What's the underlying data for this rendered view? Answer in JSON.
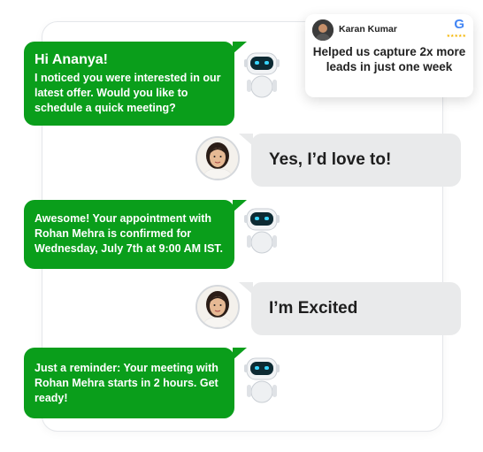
{
  "review": {
    "name": "Karan Kumar",
    "text": "Helped us capture 2x more leads in just one week",
    "logo_letter": "G",
    "stars": "★★★★★",
    "logo_icon": "google-g-icon"
  },
  "messages": [
    {
      "sender": "bot",
      "greeting": "Hi Ananya!",
      "text": "I noticed you were interested in our latest offer. Would you like to schedule a quick meeting?"
    },
    {
      "sender": "user",
      "text": "Yes, I’d love to!"
    },
    {
      "sender": "bot",
      "text": "Awesome! Your appointment with Rohan Mehra is confirmed for Wednesday, July 7th at 9:00 AM IST."
    },
    {
      "sender": "user",
      "text": "I’m Excited"
    },
    {
      "sender": "bot",
      "text": "Just a reminder: Your meeting with Rohan Mehra starts in 2 hours. Get ready!"
    }
  ],
  "colors": {
    "bot_bubble": "#0a9e1b",
    "user_bubble": "#e9eaeb",
    "robot_visor": "#0d2a33",
    "robot_eyes": "#38d6ff"
  },
  "icons": {
    "bot": "robot-icon",
    "user": "woman-avatar-icon"
  }
}
